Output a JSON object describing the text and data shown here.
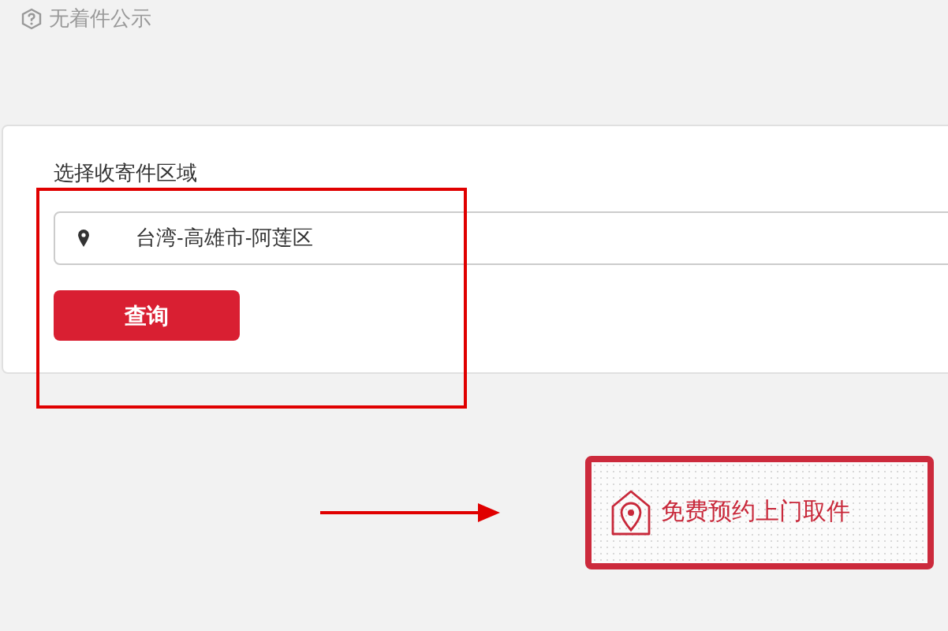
{
  "notice": {
    "text": "无着件公示"
  },
  "region_card": {
    "label": "选择收寄件区域",
    "field": {
      "value": "台湾-高雄市-阿莲区"
    },
    "query_button": "查询"
  },
  "pickup_button": {
    "label": "免费预约上门取件"
  }
}
